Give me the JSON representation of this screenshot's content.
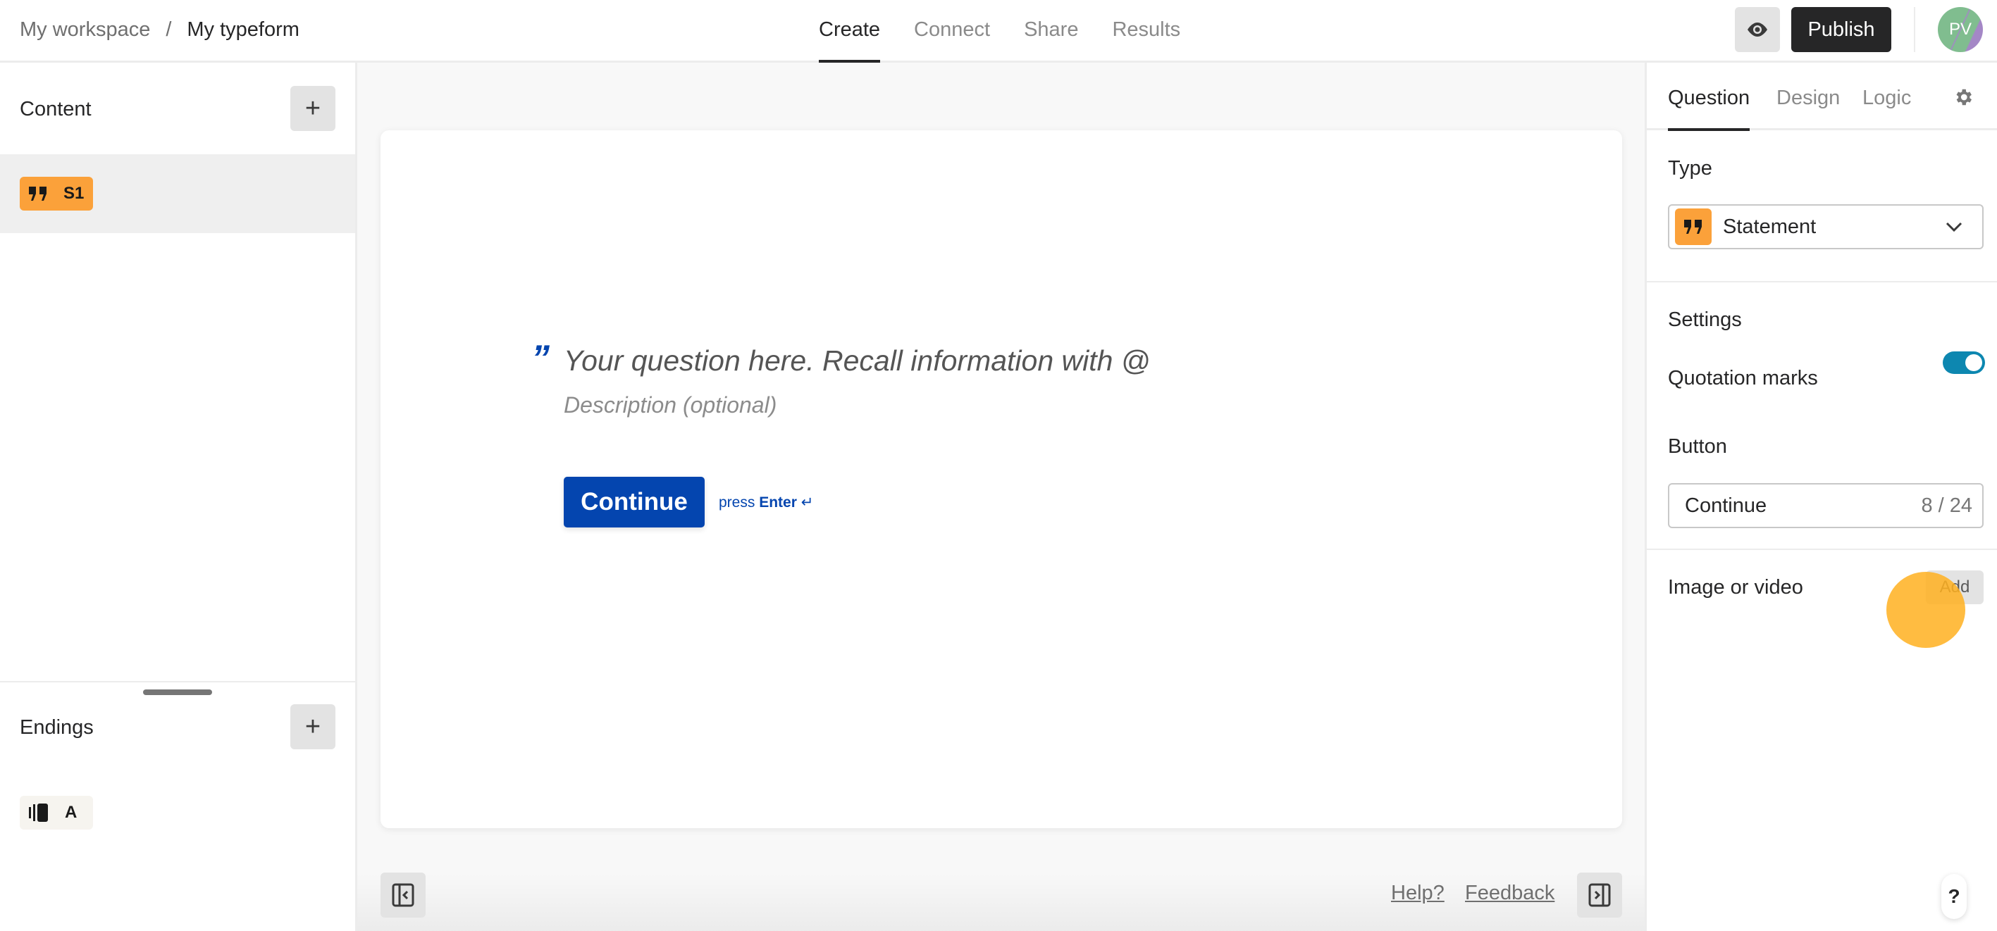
{
  "header": {
    "breadcrumb": {
      "workspace": "My workspace",
      "separator": "/",
      "form": "My typeform"
    },
    "nav_tabs": [
      {
        "label": "Create",
        "active": true
      },
      {
        "label": "Connect",
        "active": false
      },
      {
        "label": "Share",
        "active": false
      },
      {
        "label": "Results",
        "active": false
      }
    ],
    "preview_icon": "eye-icon",
    "publish_label": "Publish",
    "avatar_initials": "PV"
  },
  "sidebar": {
    "content_title": "Content",
    "add_icon": "plus-icon",
    "content_items": [
      {
        "icon": "quote-icon",
        "label": "S1",
        "color": "#fba13a"
      }
    ],
    "endings_title": "Endings",
    "ending_items": [
      {
        "icon": "ending-screen-icon",
        "label": "A"
      }
    ]
  },
  "canvas": {
    "quote_mark": "”",
    "question_placeholder": "Your question here. Recall information with @",
    "description_placeholder": "Description (optional)",
    "continue_label": "Continue",
    "press_text": "press",
    "enter_text": "Enter",
    "enter_symbol": "↵",
    "accent_color": "#0445af",
    "help_link": "Help?",
    "feedback_link": "Feedback"
  },
  "panel": {
    "tabs": [
      {
        "label": "Question",
        "active": true
      },
      {
        "label": "Design",
        "active": false
      },
      {
        "label": "Logic",
        "active": false
      }
    ],
    "type_label": "Type",
    "type_value": "Statement",
    "settings_label": "Settings",
    "quotation_marks_label": "Quotation marks",
    "quotation_marks_on": true,
    "button_label": "Button",
    "button_value": "Continue",
    "button_char_count": "8 / 24",
    "image_video_label": "Image or video",
    "add_label": "Add",
    "help_fab": "?"
  }
}
